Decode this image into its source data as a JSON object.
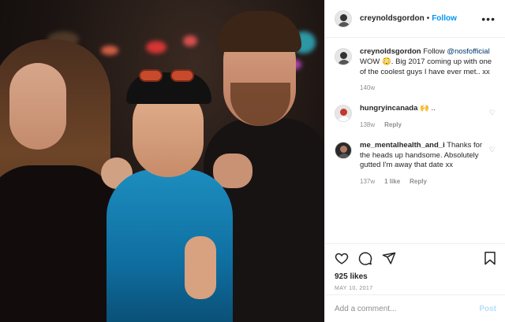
{
  "header": {
    "username": "creynoldsgordon",
    "separator": "•",
    "follow_label": "Follow",
    "more_label": "•••"
  },
  "caption": {
    "username": "creynoldsgordon",
    "pre": "Follow",
    "mention": "@nosfofficial",
    "text": "WOW 😳. Big 2017 coming up with one of the coolest guys I have ever met.. xx",
    "time": "140w"
  },
  "comments": [
    {
      "username": "hungryincanada",
      "text": "🙌 ..",
      "time": "138w",
      "likes": "",
      "reply_label": "Reply"
    },
    {
      "username": "me_mentalhealth_and_i",
      "text": "Thanks for the heads up handsome. Absolutely gutted I'm away that date xx",
      "time": "137w",
      "likes": "1 like",
      "reply_label": "Reply"
    }
  ],
  "actions": {
    "like_icon": "heart-icon",
    "comment_icon": "comment-icon",
    "share_icon": "send-icon",
    "save_icon": "bookmark-icon"
  },
  "likes": "925 likes",
  "date": "MAY 10, 2017",
  "add_comment": {
    "placeholder": "Add a comment...",
    "post_label": "Post"
  },
  "colors": {
    "accent": "#0095f6",
    "link": "#00376b",
    "muted": "#8e8e8e",
    "post_disabled": "#b2dffc"
  }
}
